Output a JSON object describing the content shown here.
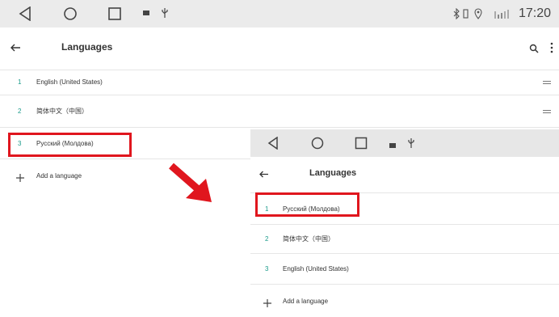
{
  "back_screen": {
    "statusbar": {
      "time": "17:20",
      "icons": [
        "back-icon",
        "home-icon",
        "recents-icon",
        "photo-icon",
        "usb-icon"
      ],
      "status_icons": [
        "bluetooth-icon",
        "vibrate-icon",
        "location-icon",
        "signal-icon"
      ]
    },
    "appbar": {
      "title": "Languages",
      "icons": [
        "back-arrow-icon",
        "search-icon",
        "more-icon"
      ]
    },
    "languages": [
      {
        "num": "1",
        "label": "English (United States)"
      },
      {
        "num": "2",
        "label": "简体中文（中国）"
      },
      {
        "num": "3",
        "label": "Русский (Молдова)"
      }
    ],
    "add_language": "Add a language"
  },
  "front_screen": {
    "appbar": {
      "title": "Languages"
    },
    "languages": [
      {
        "num": "1",
        "label": "Русский (Молдова)"
      },
      {
        "num": "2",
        "label": "简体中文（中国）"
      },
      {
        "num": "3",
        "label": "English (United States)"
      }
    ],
    "add_language": "Add a language"
  },
  "annotation": {
    "highlight_color": "#e0161e",
    "arrow_color": "#e0161e"
  }
}
